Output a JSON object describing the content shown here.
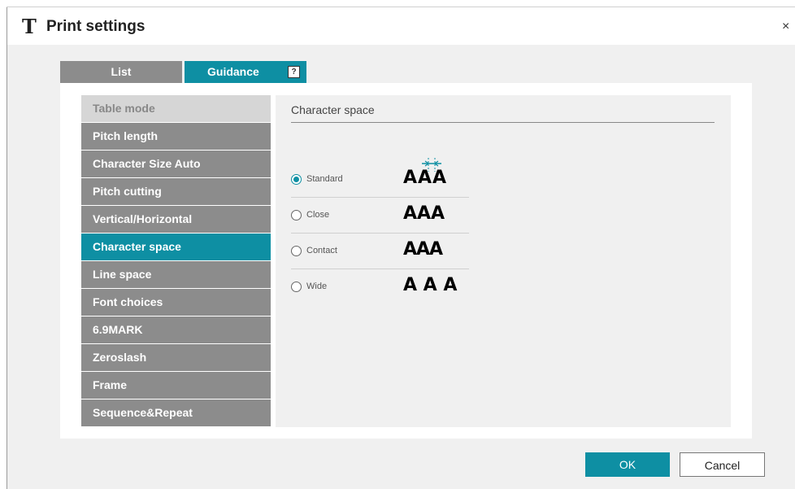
{
  "window": {
    "title": "Print settings",
    "title_icon": "T",
    "close_label": "×"
  },
  "tabs": [
    {
      "label": "List"
    },
    {
      "label": "Guidance",
      "help_icon": "?"
    }
  ],
  "menu": {
    "items": [
      {
        "label": "Table mode"
      },
      {
        "label": "Pitch length"
      },
      {
        "label": "Character Size Auto"
      },
      {
        "label": "Pitch cutting"
      },
      {
        "label": "Vertical/Horizontal"
      },
      {
        "label": "Character space"
      },
      {
        "label": "Line space"
      },
      {
        "label": "Font choices"
      },
      {
        "label": "6.9MARK"
      },
      {
        "label": "Zeroslash"
      },
      {
        "label": "Frame"
      },
      {
        "label": "Sequence&Repeat"
      }
    ],
    "selected": "Character space"
  },
  "section": {
    "title": "Character space",
    "options": [
      {
        "label": "Standard",
        "sample": "AAA",
        "checked": true
      },
      {
        "label": "Close",
        "sample": "AAA",
        "checked": false
      },
      {
        "label": "Contact",
        "sample": "AAA",
        "checked": false
      },
      {
        "label": "Wide",
        "sample": "A A A",
        "checked": false
      }
    ]
  },
  "buttons": {
    "ok": "OK",
    "cancel": "Cancel"
  },
  "colors": {
    "accent": "#0e8fa3",
    "menu_gray": "#8c8c8c",
    "header_gray": "#d6d6d6",
    "panel_bg": "#f0f0f0"
  }
}
